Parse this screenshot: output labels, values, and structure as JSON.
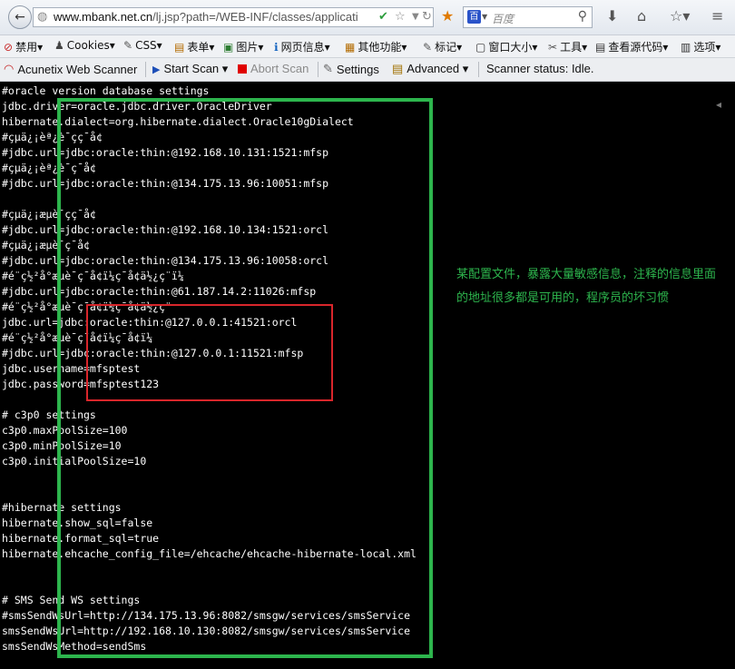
{
  "navbar": {
    "back_icon": "←",
    "url_host": "www.mbank.net.cn",
    "url_path": "/lj.jsp?path=/WEB-INF/classes/applicati",
    "search_placeholder": "百度",
    "icons": [
      "globe-icon",
      "check-icon",
      "star-icon",
      "dropdown-icon",
      "reload-icon",
      "bookmark-icon",
      "search-icon",
      "download-icon",
      "home-icon",
      "menu-icon",
      "extra-icon"
    ]
  },
  "bookmarks": [
    {
      "name": "disable",
      "label": "禁用▾",
      "icon": "⊘",
      "color": "#c62828"
    },
    {
      "name": "cookies",
      "label": "Cookies▾",
      "icon": "♟",
      "color": "#444"
    },
    {
      "name": "css",
      "label": "CSS▾",
      "icon": "✎",
      "color": "#555"
    },
    {
      "name": "forms",
      "label": "表单▾",
      "icon": "▤",
      "color": "#b36b00"
    },
    {
      "name": "images",
      "label": "图片▾",
      "icon": "▣",
      "color": "#2e7d32"
    },
    {
      "name": "info",
      "label": "网页信息▾",
      "icon": "ℹ",
      "color": "#1565c0"
    },
    {
      "name": "misc",
      "label": "其他功能▾",
      "icon": "▦",
      "color": "#b36b00"
    },
    {
      "name": "outline",
      "label": "标记▾",
      "icon": "✎",
      "color": "#555"
    },
    {
      "name": "resize",
      "label": "窗口大小▾",
      "icon": "▢",
      "color": "#333"
    },
    {
      "name": "tools",
      "label": "工具▾",
      "icon": "✂",
      "color": "#555"
    },
    {
      "name": "source",
      "label": "查看源代码▾",
      "icon": "▤",
      "color": "#333"
    },
    {
      "name": "options",
      "label": "选项▾",
      "icon": "▥",
      "color": "#333"
    }
  ],
  "scanner": {
    "name": "Acunetix Web Scanner",
    "start": "Start Scan ▾",
    "abort": "Abort Scan",
    "settings": "Settings",
    "advanced": "Advanced ▾",
    "status": "Scanner status: Idle."
  },
  "code_block_1": "#oracle version database settings\njdbc.driver=oracle.jdbc.driver.OracleDriver\nhibernate.dialect=org.hibernate.dialect.Oracle10gDialect\n#çµä¿¡èª¿è¯çç¯å¢\n#jdbc.url=jdbc:oracle:thin:@192.168.10.131:1521:mfsp\n#çµä¿¡èª¿è¯ç¯å¢\n#jdbc.url=jdbc:oracle:thin:@134.175.13.96:10051:mfsp\n\n#çµä¿¡æµè¯çç¯å¢\n#jdbc.url=jdbc:oracle:thin:@192.168.10.134:1521:orcl\n#çµä¿¡æµè¯ç¯å¢\n#jdbc.url=jdbc:oracle:thin:@134.175.13.96:10058:orcl\n#é¨ç½²å°æµè¯ç¯å¢ï¼ç¯å¢ä½¿ç¨ï¼\n#jdbc.url=jdbc:oracle:thin:@61.187.14.2:11026:mfsp\n#é¨ç½²å°æµè¯ç¯å¢ï¼ç¯å¢ä½¿ç¨",
  "code_block_2": "jdbc.url=jdbc:oracle:thin:@127.0.0.1:41521:orcl\n#é¨ç½²å°æµè¯ç¯å¢ï¼ç¯å¢ï¼\n#jdbc.url=jdbc:oracle:thin:@127.0.0.1:11521:mfsp\njdbc.username=mfsptest\njdbc.password=mfsptest123",
  "code_block_3": "# c3p0 settings\nc3p0.maxPoolSize=100\nc3p0.minPoolSize=10\nc3p0.initialPoolSize=10\n\n\n#hibernate settings\nhibernate.show_sql=false\nhibernate.format_sql=true\nhibernate.ehcache_config_file=/ehcache/ehcache-hibernate-local.xml\n\n\n# SMS Send WS settings\n#smsSendWsUrl=http://134.175.13.96:8082/smsgw/services/smsService\nsmsSendWsUrl=http://192.168.10.130:8082/smsgw/services/smsService\nsmsSendWsMethod=sendSms",
  "annotation": "某配置文件，暴露大量敏感信息，注释的信息里面的地址很多都是可用的，程序员的坏习惯",
  "colors": {
    "highlight_box": "#2db54d",
    "credential_box": "#d9262b",
    "note": "#2db54d"
  }
}
